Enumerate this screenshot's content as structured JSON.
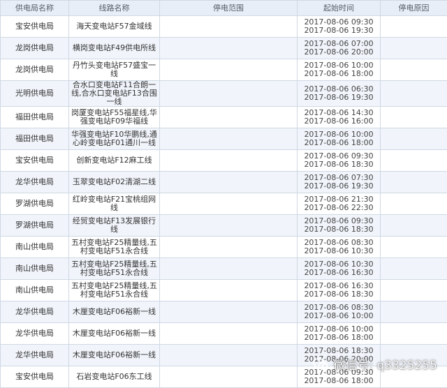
{
  "headers": {
    "bureau": "供电局名称",
    "line": "线路名称",
    "range": "停电范围",
    "time": "起始时间",
    "reason": "停电原因"
  },
  "rows": [
    {
      "bureau": "宝安供电局",
      "line": "海天变电站F57金域线",
      "range": "",
      "start": "2017-08-06 09:30",
      "end": "2017-08-06 19:30",
      "reason": ""
    },
    {
      "bureau": "龙岗供电局",
      "line": "横岗变电站F49供电所线",
      "range": "",
      "start": "2017-08-06 07:00",
      "end": "2017-08-06 20:00",
      "reason": ""
    },
    {
      "bureau": "龙岗供电局",
      "line": "丹竹头变电站F57盛宝一线",
      "range": "",
      "start": "2017-08-06 10:00",
      "end": "2017-08-06 18:00",
      "reason": ""
    },
    {
      "bureau": "光明供电局",
      "line": "合水口变电站F11合朗一线,合水口变电站F13合围一线",
      "range": "",
      "start": "2017-08-06 06:30",
      "end": "2017-08-06 19:30",
      "reason": ""
    },
    {
      "bureau": "福田供电局",
      "line": "岗厦变电站F55福星线,华强变电站F09华福线",
      "range": "",
      "start": "2017-08-06 14:30",
      "end": "2017-08-06 16:00",
      "reason": ""
    },
    {
      "bureau": "福田供电局",
      "line": "华强变电站F10华鹏线,通心岭变电站F01通川一线",
      "range": "",
      "start": "2017-08-06 10:00",
      "end": "2017-08-06 18:00",
      "reason": ""
    },
    {
      "bureau": "宝安供电局",
      "line": "创新变电站F12麻工线",
      "range": "",
      "start": "2017-08-06 09:30",
      "end": "2017-08-06 18:30",
      "reason": ""
    },
    {
      "bureau": "龙华供电局",
      "line": "玉翠变电站F02清湖二线",
      "range": "",
      "start": "2017-08-06 07:30",
      "end": "2017-08-06 19:30",
      "reason": ""
    },
    {
      "bureau": "罗湖供电局",
      "line": "红岭变电站F21宝桃组网线",
      "range": "",
      "start": "2017-08-06 21:30",
      "end": "2017-08-06 22:30",
      "reason": ""
    },
    {
      "bureau": "罗湖供电局",
      "line": "经贸变电站F13发展银行线",
      "range": "",
      "start": "2017-08-06 09:30",
      "end": "2017-08-06 18:30",
      "reason": ""
    },
    {
      "bureau": "南山供电局",
      "line": "五村变电站F25精量线,五村变电站F51永合线",
      "range": "",
      "start": "2017-08-06 08:30",
      "end": "2017-08-06 10:30",
      "reason": ""
    },
    {
      "bureau": "南山供电局",
      "line": "五村变电站F25精量线,五村变电站F51永合线",
      "range": "",
      "start": "2017-08-06 10:30",
      "end": "2017-08-06 16:30",
      "reason": ""
    },
    {
      "bureau": "南山供电局",
      "line": "五村变电站F25精量线,五村变电站F51永合线",
      "range": "",
      "start": "2017-08-06 16:30",
      "end": "2017-08-06 18:30",
      "reason": ""
    },
    {
      "bureau": "龙华供电局",
      "line": "木厘变电站F06裕新一线",
      "range": "",
      "start": "2017-08-06 08:30",
      "end": "2017-08-06 10:00",
      "reason": ""
    },
    {
      "bureau": "龙华供电局",
      "line": "木厘变电站F06裕新一线",
      "range": "",
      "start": "2017-08-06 10:00",
      "end": "2017-08-06 18:00",
      "reason": ""
    },
    {
      "bureau": "龙华供电局",
      "line": "木厘变电站F06裕新一线",
      "range": "",
      "start": "2017-08-06 18:30",
      "end": "2017-08-06 20:00",
      "reason": ""
    },
    {
      "bureau": "宝安供电局",
      "line": "石岩变电站F06东工线",
      "range": "",
      "start": "2017-08-06 09:30",
      "end": "2017-08-06 18:00",
      "reason": ""
    }
  ],
  "watermark": {
    "icon": "wechat-icon",
    "text": "微信号: q3325255",
    "color": "#ffffff"
  },
  "colors": {
    "header_bg": "#e8eef7",
    "row_alt_bg": "#f1f5fb",
    "border": "#cfd8e3"
  }
}
